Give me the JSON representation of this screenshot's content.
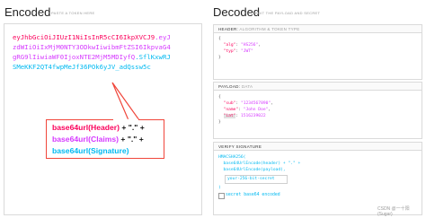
{
  "encoded": {
    "title": "Encoded",
    "subtitle": "PASTE A TOKEN HERE",
    "token_lines": [
      [
        {
          "text": "eyJhbGciOiJIUzI1NiIsInR5cCI6IkpXVCJ9",
          "color": "red"
        },
        {
          "text": ".eyJ",
          "color": "purple"
        }
      ],
      [
        {
          "text": "zdWIiOiIxMjM0NTY3ODkwIiwibmFtZSI6IkpvaG4",
          "color": "purple"
        }
      ],
      [
        {
          "text": "gRG9lIiwiaWF0IjoxNTE2MjM5MDIyfQ",
          "color": "purple"
        },
        {
          "text": ".SflKxwRJ",
          "color": "cyan"
        }
      ],
      [
        {
          "text": "SMeKKF2QT4fwpMeJf36POk6yJV_adQssw5c",
          "color": "cyan"
        }
      ]
    ],
    "callout": [
      {
        "text": "base64url(Header)",
        "color": "red",
        "suffix": " + \".\" +"
      },
      {
        "text": "base64url(Claims)",
        "color": "purple",
        "suffix": " + \".\" +"
      },
      {
        "text": "base64url(Signature)",
        "color": "cyan",
        "suffix": ""
      }
    ]
  },
  "decoded": {
    "title": "Decoded",
    "subtitle": "EDIT THE PAYLOAD AND SECRET",
    "header_section": {
      "label": "HEADER:",
      "desc": "ALGORITHM & TOKEN TYPE"
    },
    "header_json": [
      {
        "key": "\"alg\"",
        "value": "\"HS256\"",
        "comma": ","
      },
      {
        "key": "\"typ\"",
        "value": "\"JWT\"",
        "comma": ""
      }
    ],
    "payload_section": {
      "label": "PAYLOAD:",
      "desc": "DATA"
    },
    "payload_json": [
      {
        "key": "\"sub\"",
        "value": "\"1234567890\"",
        "comma": ","
      },
      {
        "key": "\"name\"",
        "value": "\"John Doe\"",
        "comma": ","
      },
      {
        "key": "\"iat\"",
        "value": "1516239022",
        "comma": ""
      }
    ],
    "signature_section": {
      "label": "VERIFY SIGNATURE",
      "desc": ""
    },
    "signature_lines": [
      "HMACSHA256(",
      "  base64UrlEncode(header) + \".\" +",
      "  base64UrlEncode(payload),"
    ],
    "secret_input": "your-256-bit-secret",
    "closing": ")",
    "checkbox_label": "secret base64 encoded",
    "watermark": "CSDN @一十阳(Sugar)"
  }
}
